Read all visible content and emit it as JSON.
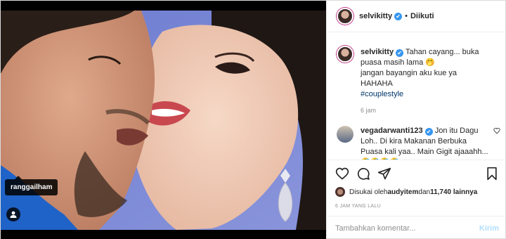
{
  "photo": {
    "tag_label": "ranggailham",
    "alt": ""
  },
  "header": {
    "username": "selvikitty",
    "verified_glyph": "✔",
    "separator": "•",
    "follow_status": "Diikuti"
  },
  "caption": {
    "username": "selvikitty",
    "verified_glyph": "✔",
    "text_line1": " Tahan cayang... buka puasa masih lama 🤭",
    "text_line2": "jangan bayangin aku kue ya HAHAHA",
    "hashtag": "#couplestyle",
    "time": "6 jam"
  },
  "comments": [
    {
      "username": "vegadarwanti123",
      "verified_glyph": "✔",
      "text": " Jon itu Dagu Loh.. Di kira Makanan Berbuka Puasa kali yaa.. Main Gigit ajaaahh... 🤣🤣🤣🤣"
    }
  ],
  "likes": {
    "prefix": "Disukai oleh ",
    "user": "audyitem",
    "middle": " dan ",
    "count": "11,740 lainnya"
  },
  "timestamp": "6 JAM YANG LALU",
  "add_comment": {
    "placeholder": "Tambahkan komentar...",
    "post_label": "Kirim"
  },
  "icons": {
    "like": "heart-icon",
    "comment": "comment-icon",
    "share": "share-icon",
    "save": "bookmark-icon"
  }
}
